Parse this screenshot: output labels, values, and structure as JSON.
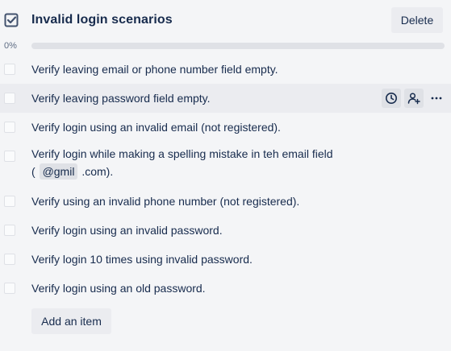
{
  "checklist": {
    "title": "Invalid login scenarios",
    "delete_label": "Delete",
    "progress": {
      "percent_label": "0%",
      "value": 0
    },
    "items": [
      {
        "text": "Verify leaving email or phone number field empty.",
        "checked": false
      },
      {
        "text": "Verify leaving password field empty.",
        "checked": false
      },
      {
        "text": "Verify login using an invalid email (not registered).",
        "checked": false
      },
      {
        "text_line1": "Verify login while making a spelling mistake in teh email field",
        "text_line2_prefix": "(",
        "chip": "@gmil",
        "text_line2_suffix": ".com).",
        "checked": false
      },
      {
        "text": "Verify using an invalid phone number (not registered).",
        "checked": false
      },
      {
        "text": "Verify login using an invalid password.",
        "checked": false
      },
      {
        "text": "Verify login 10 times using invalid password.",
        "checked": false
      },
      {
        "text": "Verify login using an old password.",
        "checked": false
      }
    ],
    "hover_actions": [
      "clock-icon",
      "assign-member-icon",
      "more-icon"
    ],
    "add_item_label": "Add an item"
  }
}
